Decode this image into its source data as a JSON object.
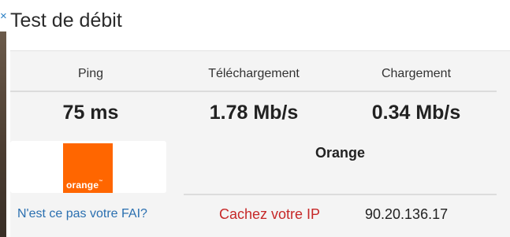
{
  "header": {
    "close_glyph": "×",
    "title": "Test de débit"
  },
  "results": {
    "ping": {
      "label": "Ping",
      "value": "75 ms"
    },
    "download": {
      "label": "Téléchargement",
      "value": "1.78 Mb/s"
    },
    "upload": {
      "label": "Chargement",
      "value": "0.34 Mb/s"
    }
  },
  "isp": {
    "logo_text": "orange",
    "logo_tm": "™",
    "logo_color": "#ff6600",
    "name": "Orange",
    "not_your_isp_link": "N'est ce pas votre FAI?",
    "hide_ip_link": "Cachez votre IP",
    "ip_address": "90.20.136.17"
  },
  "colors": {
    "link_blue": "#2a6fb0",
    "link_red": "#c62828",
    "panel_bg": "#f4f4f4"
  }
}
